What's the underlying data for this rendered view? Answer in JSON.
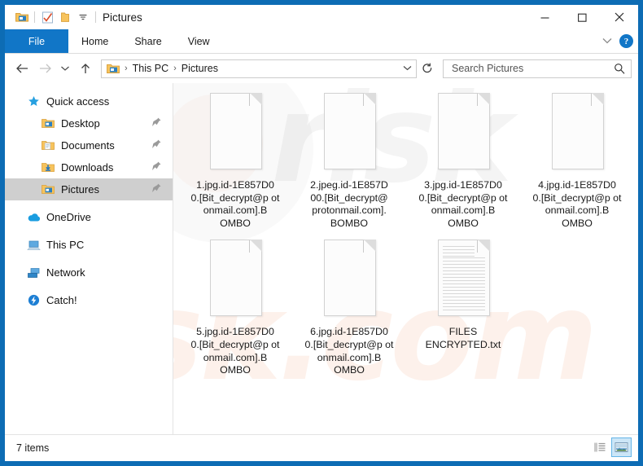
{
  "window": {
    "title": "Pictures",
    "quick_access_toolbar": [
      {
        "name": "folder-properties-icon",
        "label": "Properties"
      },
      {
        "name": "new-folder-icon",
        "label": "New folder"
      },
      {
        "name": "customize-qat-icon",
        "label": "Customize Quick Access Toolbar"
      }
    ],
    "controls": {
      "minimize": "–",
      "maximize": "☐",
      "close": "×"
    }
  },
  "ribbon": {
    "tabs": [
      {
        "label": "File",
        "selected": true
      },
      {
        "label": "Home",
        "selected": false
      },
      {
        "label": "Share",
        "selected": false
      },
      {
        "label": "View",
        "selected": false
      }
    ],
    "collapse_chevron": "˅",
    "help_label": "?"
  },
  "address": {
    "back": "←",
    "forward": "→",
    "recent": "˅",
    "up": "↑",
    "breadcrumb": [
      "This PC",
      "Pictures"
    ],
    "breadcrumb_separator": "›",
    "dropdown": "˅",
    "refresh": "↻"
  },
  "search": {
    "placeholder": "Search Pictures",
    "value": "",
    "icon": "search-icon"
  },
  "sidebar": {
    "items": [
      {
        "label": "Quick access",
        "icon": "star-icon",
        "indent": false,
        "pinned": false,
        "selected": false
      },
      {
        "label": "Desktop",
        "icon": "folder-desktop-icon",
        "indent": true,
        "pinned": true,
        "selected": false
      },
      {
        "label": "Documents",
        "icon": "folder-documents-icon",
        "indent": true,
        "pinned": true,
        "selected": false
      },
      {
        "label": "Downloads",
        "icon": "folder-downloads-icon",
        "indent": true,
        "pinned": true,
        "selected": false
      },
      {
        "label": "Pictures",
        "icon": "folder-pictures-icon",
        "indent": true,
        "pinned": true,
        "selected": true
      },
      {
        "label": "OneDrive",
        "icon": "onedrive-cloud-icon",
        "indent": false,
        "pinned": false,
        "selected": false
      },
      {
        "label": "This PC",
        "icon": "this-pc-icon",
        "indent": false,
        "pinned": false,
        "selected": false
      },
      {
        "label": "Network",
        "icon": "network-icon",
        "indent": false,
        "pinned": false,
        "selected": false
      },
      {
        "label": "Catch!",
        "icon": "catch-app-icon",
        "indent": false,
        "pinned": false,
        "selected": false
      }
    ],
    "pin_glyph": "📌"
  },
  "files": [
    {
      "name": "1.jpg.id-1E857D00.[Bit_decrypt@protonmail.com].BOMBO",
      "display": "1.jpg.id-1E857D0\n0.[Bit_decrypt@p\rotonmail.com].B\nOMBO",
      "type": "blank-file"
    },
    {
      "name": "2.jpeg.id-1E857D00.[Bit_decrypt@protonmail.com].BOMBO",
      "display": "2.jpeg.id-1E857D\n00.[Bit_decrypt@\nprotonmail.com].\nBOMBO",
      "type": "blank-file"
    },
    {
      "name": "3.jpg.id-1E857D00.[Bit_decrypt@protonmail.com].BOMBO",
      "display": "3.jpg.id-1E857D0\n0.[Bit_decrypt@p\rotonmail.com].B\nOMBO",
      "type": "blank-file"
    },
    {
      "name": "4.jpg.id-1E857D00.[Bit_decrypt@protonmail.com].BOMBO",
      "display": "4.jpg.id-1E857D0\n0.[Bit_decrypt@p\rotonmail.com].B\nOMBO",
      "type": "blank-file"
    },
    {
      "name": "5.jpg.id-1E857D00.[Bit_decrypt@protonmail.com].BOMBO",
      "display": "5.jpg.id-1E857D0\n0.[Bit_decrypt@p\rotonmail.com].B\nOMBO",
      "type": "blank-file"
    },
    {
      "name": "6.jpg.id-1E857D00.[Bit_decrypt@protonmail.com].BOMBO",
      "display": "6.jpg.id-1E857D0\n0.[Bit_decrypt@p\rotonmail.com].B\nOMBO",
      "type": "blank-file"
    },
    {
      "name": "FILES ENCRYPTED.txt",
      "display": "FILES\nENCRYPTED.txt",
      "type": "text-file"
    }
  ],
  "statusbar": {
    "item_count": "7 items",
    "views": [
      {
        "name": "details-view",
        "selected": false
      },
      {
        "name": "large-icons-view",
        "selected": true
      }
    ]
  },
  "watermark": {
    "text_grey": "risk",
    "text_orange": "risk.com"
  },
  "colors": {
    "frame_blue": "#0d6cb4",
    "tab_blue": "#1176c7",
    "selection_grey": "#cfcfcf",
    "view_selected": "#cce6f7"
  }
}
